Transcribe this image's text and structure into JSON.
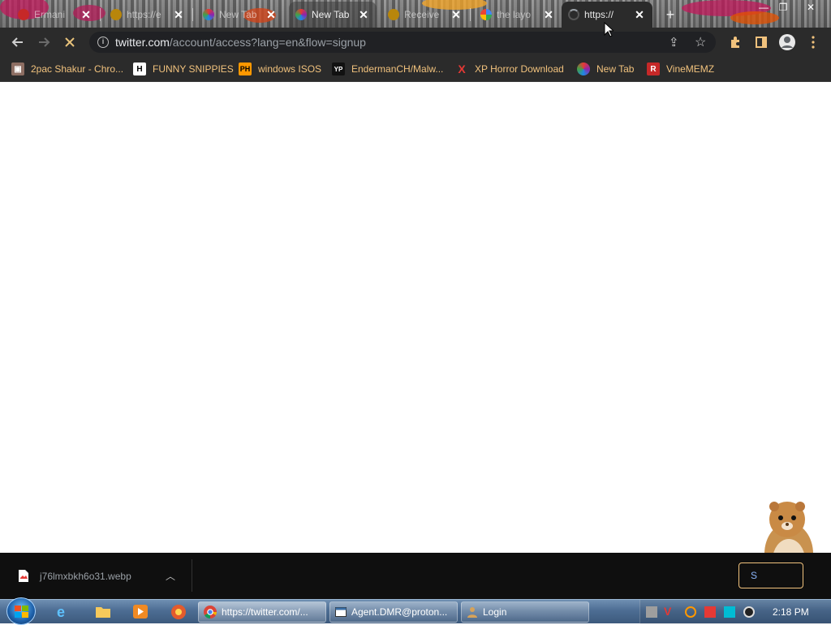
{
  "browser": {
    "tabs": [
      {
        "title": "Ermani",
        "favicon": "red-circle-icon",
        "state": "inactive"
      },
      {
        "title": "https://e",
        "favicon": "loading-circle-icon",
        "state": "inactive"
      },
      {
        "title": "New Tab",
        "favicon": "colorful-ball-icon",
        "state": "inactive"
      },
      {
        "title": "New Tab",
        "favicon": "colorful-ball-icon",
        "state": "semi"
      },
      {
        "title": "Receive",
        "favicon": "loading-circle-icon",
        "state": "inactive"
      },
      {
        "title": "the layo",
        "favicon": "google-g-icon",
        "state": "inactive"
      },
      {
        "title": "https://",
        "favicon": "loading-spinner-icon",
        "state": "active"
      }
    ],
    "new_tab_label": "+",
    "url_host": "twitter.com",
    "url_path": "/account/access?lang=en&flow=signup",
    "bookmarks": [
      {
        "label": "2pac Shakur - Chro...",
        "icon": "briefcase-icon"
      },
      {
        "label": "FUNNY SNIPPIES",
        "icon": "H"
      },
      {
        "label": "windows ISOS",
        "icon": "PH"
      },
      {
        "label": "EndermanCH/Malw...",
        "icon": "YP"
      },
      {
        "label": "XP Horror Download",
        "icon": "X"
      },
      {
        "label": "New Tab",
        "icon": "colorful-ball-icon"
      },
      {
        "label": "VineMEMZ",
        "icon": "R"
      }
    ],
    "accent": "#f1c27d"
  },
  "download": {
    "filename": "j76lmxbkh6o31.webp",
    "show_all_label": "S"
  },
  "taskbar": {
    "tasks": [
      {
        "label": "https://twitter.com/...",
        "icon": "chrome-icon"
      },
      {
        "label": "Agent.DMR@proton...",
        "icon": "window-icon"
      },
      {
        "label": "Login",
        "icon": "user-icon"
      }
    ],
    "clock": "2:18 PM"
  }
}
